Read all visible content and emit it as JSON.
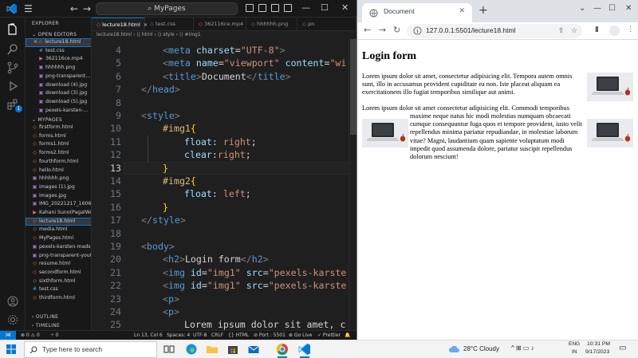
{
  "vscode": {
    "title_search": "MyPages",
    "menu_glyph": "☰",
    "back_glyph": "←",
    "forward_glyph": "→",
    "search_glyph": "⌕",
    "sidebar": {
      "explorer_label": "EXPLORER",
      "open_editors_label": "OPEN EDITORS",
      "open_editors": [
        {
          "name": "lecture18.html",
          "type": "html",
          "active": true,
          "close": "×"
        },
        {
          "name": "test.css",
          "type": "css"
        },
        {
          "name": "362116ce.mp4",
          "type": "vid"
        },
        {
          "name": "hhhhhh.png",
          "type": "img"
        },
        {
          "name": "png-transparent...",
          "type": "img"
        },
        {
          "name": "download (4).jpg",
          "type": "img"
        },
        {
          "name": "download (3).jpg",
          "type": "img"
        },
        {
          "name": "download (5).jpg",
          "type": "img"
        },
        {
          "name": "pexels-karsten-...",
          "type": "img"
        }
      ],
      "folder_label": "MYPAGES",
      "files": [
        {
          "name": "firstform.html",
          "type": "html"
        },
        {
          "name": "forms.html",
          "type": "html"
        },
        {
          "name": "forms1.html",
          "type": "html"
        },
        {
          "name": "forms2.html",
          "type": "html"
        },
        {
          "name": "fourthform.html",
          "type": "html"
        },
        {
          "name": "hello.html",
          "type": "html"
        },
        {
          "name": "hhhhhh.png",
          "type": "img"
        },
        {
          "name": "images (1).jpg",
          "type": "img"
        },
        {
          "name": "images.jpg",
          "type": "img"
        },
        {
          "name": "IMG_20221217_1606...",
          "type": "img"
        },
        {
          "name": "Kahani Suno(PagalWo...",
          "type": "vid"
        },
        {
          "name": "lecture18.html",
          "type": "html",
          "active": true
        },
        {
          "name": "media.html",
          "type": "html"
        },
        {
          "name": "MyPages.html",
          "type": "html"
        },
        {
          "name": "pexels-karsten-mads...",
          "type": "img"
        },
        {
          "name": "png-transparent-yout...",
          "type": "img"
        },
        {
          "name": "resume.html",
          "type": "html"
        },
        {
          "name": "secondform.html",
          "type": "html"
        },
        {
          "name": "sixthform.html",
          "type": "html"
        },
        {
          "name": "test.css",
          "type": "css"
        },
        {
          "name": "thirdform.html",
          "type": "html"
        }
      ],
      "outline_label": "OUTLINE",
      "timeline_label": "TIMELINE"
    },
    "tabs": [
      {
        "name": "lecture18.html",
        "close": "×"
      },
      {
        "name": "test.css"
      },
      {
        "name": "362116ce.mp4"
      },
      {
        "name": "hhhhhh.png"
      },
      {
        "name": "pn"
      }
    ],
    "breadcrumb": "lecture18.html › ⟨⟩ html › ⟨⟩ style › ⟨⟩ #img1",
    "lines": [
      {
        "n": "4",
        "tokens": [
          [
            "t-br",
            "<"
          ],
          [
            "t-tag",
            "meta"
          ],
          [
            "t-txt",
            " "
          ],
          [
            "t-attr",
            "charset"
          ],
          [
            "t-txt",
            "="
          ],
          [
            "t-str",
            "\"UTF-8\""
          ],
          [
            "t-br",
            ">"
          ]
        ],
        "indent": 1
      },
      {
        "n": "5",
        "tokens": [
          [
            "t-br",
            "<"
          ],
          [
            "t-tag",
            "meta"
          ],
          [
            "t-txt",
            " "
          ],
          [
            "t-attr",
            "name"
          ],
          [
            "t-txt",
            "="
          ],
          [
            "t-str",
            "\"viewport\""
          ],
          [
            "t-txt",
            " "
          ],
          [
            "t-attr",
            "content"
          ],
          [
            "t-txt",
            "="
          ],
          [
            "t-str",
            "\"wi"
          ]
        ],
        "indent": 1
      },
      {
        "n": "6",
        "tokens": [
          [
            "t-br",
            "<"
          ],
          [
            "t-tag",
            "title"
          ],
          [
            "t-br",
            ">"
          ],
          [
            "t-txt",
            "Document"
          ],
          [
            "t-br",
            "</"
          ],
          [
            "t-tag",
            "title"
          ],
          [
            "t-br",
            ">"
          ]
        ],
        "indent": 1
      },
      {
        "n": "7",
        "tokens": [
          [
            "t-br",
            "</"
          ],
          [
            "t-tag",
            "head"
          ],
          [
            "t-br",
            ">"
          ]
        ],
        "indent": 0
      },
      {
        "n": "8",
        "tokens": [],
        "indent": 0
      },
      {
        "n": "9",
        "tokens": [
          [
            "t-br",
            "<"
          ],
          [
            "t-tag",
            "style"
          ],
          [
            "t-br",
            ">"
          ]
        ],
        "indent": 0
      },
      {
        "n": "10",
        "tokens": [
          [
            "t-sel",
            "#img1"
          ],
          [
            "t-brace",
            "{"
          ]
        ],
        "indent": 1
      },
      {
        "n": "11",
        "tokens": [
          [
            "t-prop",
            "float"
          ],
          [
            "t-txt",
            ": "
          ],
          [
            "t-val",
            "right"
          ],
          [
            "t-txt",
            ";"
          ]
        ],
        "indent": 2
      },
      {
        "n": "12",
        "tokens": [
          [
            "t-prop",
            "clear"
          ],
          [
            "t-txt",
            ":"
          ],
          [
            "t-val",
            "right"
          ],
          [
            "t-txt",
            ";"
          ]
        ],
        "indent": 2
      },
      {
        "n": "13",
        "tokens": [
          [
            "t-brace",
            "}"
          ]
        ],
        "indent": 1
      },
      {
        "n": "14",
        "tokens": [
          [
            "t-sel",
            "#img2"
          ],
          [
            "t-brace",
            "{"
          ]
        ],
        "indent": 1
      },
      {
        "n": "15",
        "tokens": [
          [
            "t-prop",
            "float"
          ],
          [
            "t-txt",
            ": "
          ],
          [
            "t-val",
            "left"
          ],
          [
            "t-txt",
            ";"
          ]
        ],
        "indent": 2
      },
      {
        "n": "16",
        "tokens": [
          [
            "t-brace",
            "}"
          ]
        ],
        "indent": 1
      },
      {
        "n": "17",
        "tokens": [
          [
            "t-br",
            "</"
          ],
          [
            "t-tag",
            "style"
          ],
          [
            "t-br",
            ">"
          ]
        ],
        "indent": 0
      },
      {
        "n": "18",
        "tokens": [],
        "indent": 0
      },
      {
        "n": "19",
        "tokens": [
          [
            "t-br",
            "<"
          ],
          [
            "t-tag",
            "body"
          ],
          [
            "t-br",
            ">"
          ]
        ],
        "indent": 0
      },
      {
        "n": "20",
        "tokens": [
          [
            "t-br",
            "<"
          ],
          [
            "t-tag",
            "h2"
          ],
          [
            "t-br",
            ">"
          ],
          [
            "t-txt",
            "Login form"
          ],
          [
            "t-br",
            "</"
          ],
          [
            "t-tag",
            "h2"
          ],
          [
            "t-br",
            ">"
          ]
        ],
        "indent": 1
      },
      {
        "n": "21",
        "tokens": [
          [
            "t-br",
            "<"
          ],
          [
            "t-tag",
            "img"
          ],
          [
            "t-txt",
            " "
          ],
          [
            "t-attr",
            "id"
          ],
          [
            "t-txt",
            "="
          ],
          [
            "t-str",
            "\"img1\""
          ],
          [
            "t-txt",
            " "
          ],
          [
            "t-attr",
            "src"
          ],
          [
            "t-txt",
            "="
          ],
          [
            "t-str",
            "\"pexels-karste"
          ]
        ],
        "indent": 1
      },
      {
        "n": "22",
        "tokens": [
          [
            "t-br",
            "<"
          ],
          [
            "t-tag",
            "img"
          ],
          [
            "t-txt",
            " "
          ],
          [
            "t-attr",
            "id"
          ],
          [
            "t-txt",
            "="
          ],
          [
            "t-str",
            "\"img1\""
          ],
          [
            "t-txt",
            " "
          ],
          [
            "t-attr",
            "src"
          ],
          [
            "t-txt",
            "="
          ],
          [
            "t-str",
            "\"pexels-karste"
          ]
        ],
        "indent": 1
      },
      {
        "n": "23",
        "tokens": [
          [
            "t-br",
            "<"
          ],
          [
            "t-tag",
            "p"
          ],
          [
            "t-br",
            ">"
          ]
        ],
        "indent": 1
      },
      {
        "n": "24",
        "tokens": [
          [
            "t-br",
            "<"
          ],
          [
            "t-tag",
            "p"
          ],
          [
            "t-br",
            ">"
          ]
        ],
        "indent": 1
      },
      {
        "n": "25",
        "tokens": [
          [
            "t-txt",
            "Lorem ipsum dolor sit amet, c"
          ]
        ],
        "indent": 2
      }
    ],
    "current_line": "13",
    "status": {
      "remote": "⋊",
      "problems": "⊗ 0 ⚠ 0",
      "ports": "⑂ 0",
      "position": "Ln 13, Col 6",
      "spaces": "Spaces: 4",
      "encoding": "UTF-8",
      "eol": "CRLF",
      "language": "{} HTML",
      "port": "⊘ Port : 5501",
      "golive": "⊗ Go Live",
      "prettier": "✓ Prettier",
      "bell": "🔔"
    }
  },
  "chrome": {
    "tab_title": "Document",
    "tab_close": "✕",
    "new_tab": "+",
    "minimize": "—",
    "maximize": "☐",
    "close": "✕",
    "back": "←",
    "forward": "→",
    "reload": "↻",
    "url": "127.0.0.1:5501/lecture18.html",
    "share_glyph": "⇪",
    "star_glyph": "☆",
    "sidepanel_glyph": "▮",
    "menu_glyph": "⋮",
    "page": {
      "heading": "Login form",
      "para1": "Lorem ipsum dolor sit amet, consectetur adipisicing elit. Tempora autem omnis sunt, illo in accusamus provident cupiditate ea non. Iste placeat aliquam ea exercitationem illo fugiat temporibus similique aut animi.",
      "para2": "Lorem ipsum dolor sit amet consectetur adipisicing elit. Commodi temporibus maxime neque natus hic modi molestias numquam obcaecati cumque consequuntur fuga quos et tempore provident, iusto velit repellendus minima pariatur repudiandae, in molestiae laborum vitae? Magni, laudantium quam sapiente voluptatum modi impedit quod assumenda dolore, pariatur suscipit repellendus dolorum nesciunt!"
    }
  },
  "taskbar": {
    "search_placeholder": "Type here to search",
    "weather": "28°C  Cloudy",
    "tray_icons": "^  ⊞  ▭  ♪",
    "lang_top": "ENG",
    "lang_bottom": "IN",
    "time": "10:31 PM",
    "date": "9/17/2023",
    "notif_glyph": "▭"
  },
  "colors": {
    "vscode_accent": "#0078d4",
    "html_icon": "#e37933",
    "css_icon": "#519aba",
    "taskbar": "#f3f3f3"
  }
}
